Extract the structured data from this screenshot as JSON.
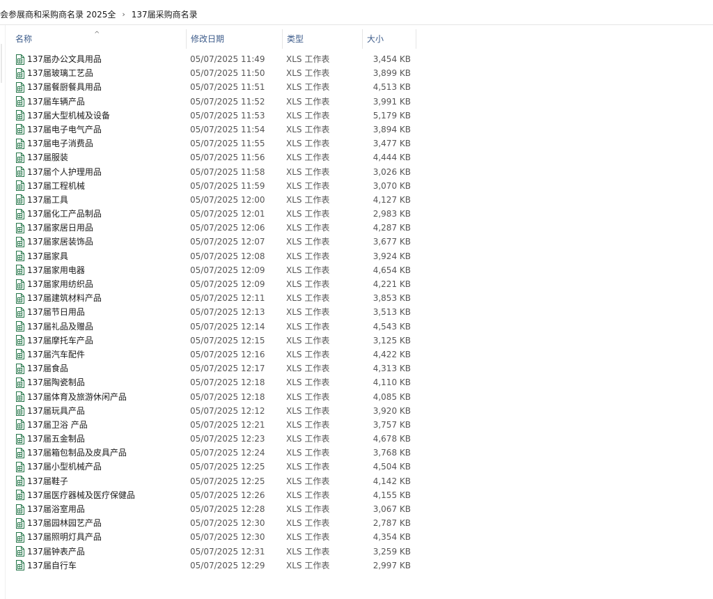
{
  "breadcrumb": [
    "会参展商和采购商名录 2025全",
    "137届采购商名录"
  ],
  "breadcrumb_separator": "›",
  "columns": {
    "name": "名称",
    "date": "修改日期",
    "type": "类型",
    "size": "大小"
  },
  "sort_indicator": "^",
  "icon": "excel-file-icon",
  "accent_color": "#217346",
  "files": [
    {
      "name": "137届办公文具用品",
      "date": "05/07/2025 11:49",
      "type": "XLS 工作表",
      "size": "3,454 KB"
    },
    {
      "name": "137届玻璃工艺品",
      "date": "05/07/2025 11:50",
      "type": "XLS 工作表",
      "size": "3,899 KB"
    },
    {
      "name": "137届餐厨餐具用品",
      "date": "05/07/2025 11:51",
      "type": "XLS 工作表",
      "size": "4,513 KB"
    },
    {
      "name": "137届车辆产品",
      "date": "05/07/2025 11:52",
      "type": "XLS 工作表",
      "size": "3,991 KB"
    },
    {
      "name": "137届大型机械及设备",
      "date": "05/07/2025 11:53",
      "type": "XLS 工作表",
      "size": "5,179 KB"
    },
    {
      "name": "137届电子电气产品",
      "date": "05/07/2025 11:54",
      "type": "XLS 工作表",
      "size": "3,894 KB"
    },
    {
      "name": "137届电子消费品",
      "date": "05/07/2025 11:55",
      "type": "XLS 工作表",
      "size": "3,477 KB"
    },
    {
      "name": "137届服装",
      "date": "05/07/2025 11:56",
      "type": "XLS 工作表",
      "size": "4,444 KB"
    },
    {
      "name": "137届个人护理用品",
      "date": "05/07/2025 11:58",
      "type": "XLS 工作表",
      "size": "3,026 KB"
    },
    {
      "name": "137届工程机械",
      "date": "05/07/2025 11:59",
      "type": "XLS 工作表",
      "size": "3,070 KB"
    },
    {
      "name": "137届工具",
      "date": "05/07/2025 12:00",
      "type": "XLS 工作表",
      "size": "4,127 KB"
    },
    {
      "name": "137届化工产品制品",
      "date": "05/07/2025 12:01",
      "type": "XLS 工作表",
      "size": "2,983 KB"
    },
    {
      "name": "137届家居日用品",
      "date": "05/07/2025 12:06",
      "type": "XLS 工作表",
      "size": "4,287 KB"
    },
    {
      "name": "137届家居装饰品",
      "date": "05/07/2025 12:07",
      "type": "XLS 工作表",
      "size": "3,677 KB"
    },
    {
      "name": "137届家具",
      "date": "05/07/2025 12:08",
      "type": "XLS 工作表",
      "size": "3,924 KB"
    },
    {
      "name": "137届家用电器",
      "date": "05/07/2025 12:09",
      "type": "XLS 工作表",
      "size": "4,654 KB"
    },
    {
      "name": "137届家用纺织品",
      "date": "05/07/2025 12:09",
      "type": "XLS 工作表",
      "size": "4,221 KB"
    },
    {
      "name": "137届建筑材料产品",
      "date": "05/07/2025 12:11",
      "type": "XLS 工作表",
      "size": "3,853 KB"
    },
    {
      "name": "137届节日用品",
      "date": "05/07/2025 12:13",
      "type": "XLS 工作表",
      "size": "3,513 KB"
    },
    {
      "name": "137届礼品及赠品",
      "date": "05/07/2025 12:14",
      "type": "XLS 工作表",
      "size": "4,543 KB"
    },
    {
      "name": "137届摩托车产品",
      "date": "05/07/2025 12:15",
      "type": "XLS 工作表",
      "size": "3,125 KB"
    },
    {
      "name": "137届汽车配件",
      "date": "05/07/2025 12:16",
      "type": "XLS 工作表",
      "size": "4,422 KB"
    },
    {
      "name": "137届食品",
      "date": "05/07/2025 12:17",
      "type": "XLS 工作表",
      "size": "4,313 KB"
    },
    {
      "name": "137届陶瓷制品",
      "date": "05/07/2025 12:18",
      "type": "XLS 工作表",
      "size": "4,110 KB"
    },
    {
      "name": "137届体育及旅游休闲产品",
      "date": "05/07/2025 12:18",
      "type": "XLS 工作表",
      "size": "4,085 KB"
    },
    {
      "name": "137届玩具产品",
      "date": "05/07/2025 12:12",
      "type": "XLS 工作表",
      "size": "3,920 KB"
    },
    {
      "name": "137届卫浴 产品",
      "date": "05/07/2025 12:21",
      "type": "XLS 工作表",
      "size": "3,757 KB"
    },
    {
      "name": "137届五金制品",
      "date": "05/07/2025 12:23",
      "type": "XLS 工作表",
      "size": "4,678 KB"
    },
    {
      "name": "137届箱包制品及皮具产品",
      "date": "05/07/2025 12:24",
      "type": "XLS 工作表",
      "size": "3,768 KB"
    },
    {
      "name": "137届小型机械产品",
      "date": "05/07/2025 12:25",
      "type": "XLS 工作表",
      "size": "4,504 KB"
    },
    {
      "name": "137届鞋子",
      "date": "05/07/2025 12:25",
      "type": "XLS 工作表",
      "size": "4,142 KB"
    },
    {
      "name": "137届医疗器械及医疗保健品",
      "date": "05/07/2025 12:26",
      "type": "XLS 工作表",
      "size": "4,155 KB"
    },
    {
      "name": "137届浴室用品",
      "date": "05/07/2025 12:28",
      "type": "XLS 工作表",
      "size": "3,067 KB"
    },
    {
      "name": "137届园林园艺产品",
      "date": "05/07/2025 12:30",
      "type": "XLS 工作表",
      "size": "2,787 KB"
    },
    {
      "name": "137届照明灯具产品",
      "date": "05/07/2025 12:30",
      "type": "XLS 工作表",
      "size": "4,354 KB"
    },
    {
      "name": "137届钟表产品",
      "date": "05/07/2025 12:31",
      "type": "XLS 工作表",
      "size": "3,259 KB"
    },
    {
      "name": "137届自行车",
      "date": "05/07/2025 12:29",
      "type": "XLS 工作表",
      "size": "2,997 KB"
    }
  ]
}
